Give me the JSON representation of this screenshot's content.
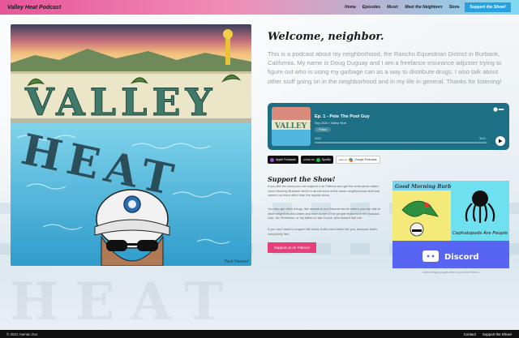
{
  "header": {
    "brand": "Valley Heat Podcast",
    "nav": [
      "Home",
      "Episodes",
      "Music",
      "Meet the Neighbors",
      "Store"
    ],
    "support_button": "Support the Show!"
  },
  "hero": {
    "art_title_top": "VALLEY",
    "art_title_bottom": "HEAT",
    "artist_signature": "Paul Hanser"
  },
  "welcome": {
    "heading": "Welcome, neighbor.",
    "body": "This is a podcast about my neighborhood, the Rancho Equestrian District in Burbank, California. My name is Doug Duguay and I am a freelance insurance adjuster trying to figure out who is using my garbage can as a way to distribute drugs. I also talk about other stuff going on in the neighborhood and in my life in general. Thanks for listening!"
  },
  "player": {
    "episode_title": "Ep. 1 - Pete The Pool Guy",
    "meta": "Sep 2020 • Valley Heat",
    "follow_label": "Follow",
    "time_start": "00:00",
    "time_end": "35:00",
    "progress": 0.0,
    "art_label": "VALLEY HEAT",
    "accent_color": "#1d6f86"
  },
  "badges": [
    {
      "top": "Listen on",
      "label": "Apple Podcasts",
      "icon": "apple-podcasts-icon",
      "color": "#a24cd6"
    },
    {
      "top": "LISTEN ON",
      "label": "Spotify",
      "icon": "spotify-icon",
      "color": "#1db954"
    },
    {
      "top": "Listen on",
      "label": "Google Podcasts",
      "icon": "google-podcasts-icon",
      "color": "#4285f4"
    }
  ],
  "support": {
    "heading": "Support the Show!",
    "para1": "If you like the show you can support it on Patreon and get the extra show called Good Morning Burbank which is about more of the same neighborhood stuff and comes out more often than the regular show.",
    "para2": "You also get other things, like access to our Discord server where you can talk to other neighbors who listen and even some of the people featured in the podcast. Like, Jen Robinson, or my father-in-law Chuck, who doesn't like me.",
    "para3": "If you don't want to support the show, that's even better for you, because that's completely free.",
    "patreon_button": "Support us on Patreon",
    "promo_gmb": "Good Morning Burbank",
    "promo_cephalopods": "Cephalopods Are People",
    "promo_discord": "Discord",
    "promo_caption": "Some things you get when you do the Patreon"
  },
  "footer": {
    "copyright": "© 2021 Human Zoo",
    "links": [
      "Contact",
      "Support the Show!"
    ]
  }
}
